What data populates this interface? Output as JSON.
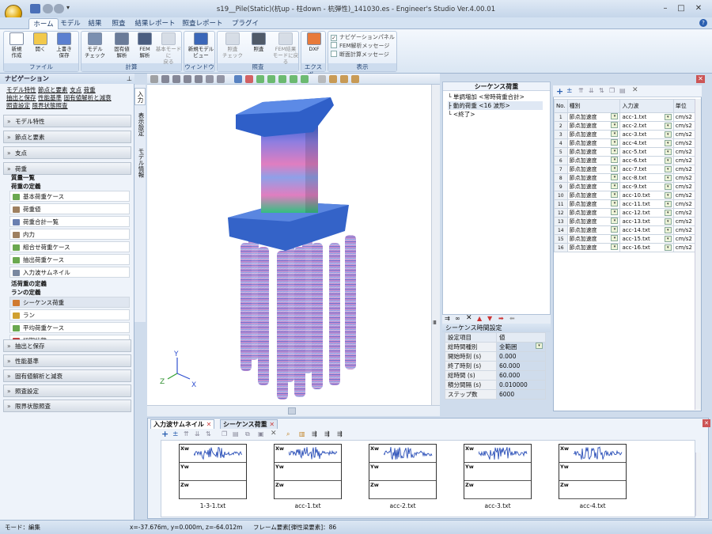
{
  "window": {
    "title": "s19__Pile(Static)(杭up - 柱down - 杭弾性)_141030.es - Engineer's Studio Ver.4.00.01",
    "controls": [
      "–",
      "□",
      "✕"
    ]
  },
  "ribbon_tabs": [
    "ホーム",
    "モデル",
    "結果",
    "照査",
    "結果レポート",
    "照査レポート",
    "プラグイン"
  ],
  "ribbon_groups": {
    "file": "ファイル",
    "calc": "計算",
    "window": "ウィンドウ",
    "check": "照査",
    "export": "エクスポ...",
    "display": "表示"
  },
  "ribbon_buttons": [
    {
      "label": "新規\n作成",
      "icon": "new-file-icon",
      "color": "#ffffff",
      "disabled": false
    },
    {
      "label": "開く",
      "icon": "open-folder-icon",
      "color": "#f2c94c",
      "disabled": false
    },
    {
      "label": "上書き\n保存",
      "icon": "save-icon",
      "color": "#5b7fd0",
      "disabled": false
    },
    {
      "label": "モデル\nチェック",
      "icon": "model-check-icon",
      "color": "#7a8fb0",
      "disabled": false
    },
    {
      "label": "固有値\n解析",
      "icon": "eigen-icon",
      "color": "#6a7b98",
      "disabled": false
    },
    {
      "label": "FEM\n解析",
      "icon": "fem-icon",
      "color": "#4a5d80",
      "disabled": false
    },
    {
      "label": "基本モードに\n戻る",
      "icon": "basic-mode-icon",
      "color": "#b8c2d0",
      "disabled": true
    },
    {
      "label": "新規モデル\nビュー",
      "icon": "model-view-icon",
      "color": "#3a66b8",
      "disabled": false
    },
    {
      "label": "照査\nチェック",
      "icon": "check-icon",
      "color": "#b8c2d0",
      "disabled": true
    },
    {
      "label": "照査",
      "icon": "verify-icon",
      "color": "#505a68",
      "disabled": false
    },
    {
      "label": "FEM結果\nモードに戻る",
      "icon": "fem-mode-icon",
      "color": "#b8c2d0",
      "disabled": true
    },
    {
      "label": "DXF",
      "icon": "dxf-icon",
      "color": "#e87a3a",
      "disabled": false
    }
  ],
  "display_options": [
    {
      "label": "ナビゲーションパネル",
      "checked": true
    },
    {
      "label": "FEM解析メッセージ",
      "checked": false
    },
    {
      "label": "断面計算メッセージ",
      "checked": false
    }
  ],
  "nav": {
    "title": "ナビゲーション",
    "links": [
      [
        "モデル特性",
        "節点と要素",
        "支点",
        "荷重"
      ],
      [
        "抽出と保存",
        "性能基準",
        "固有値解析と減衰"
      ],
      [
        "照査設定",
        "限界状態照査"
      ]
    ],
    "sections_top": [
      "モデル特性",
      "節点と要素",
      "支点",
      "荷重"
    ],
    "load_items": [
      {
        "type": "head",
        "label": "質量一覧"
      },
      {
        "type": "head",
        "label": "荷重の定義"
      },
      {
        "type": "item",
        "label": "基本荷重ケース",
        "icon_color": "#6aa84f"
      },
      {
        "type": "item",
        "label": "荷重値",
        "icon_color": "#9e8060"
      },
      {
        "type": "item",
        "label": "荷重合計一覧",
        "icon_color": "#6a7fb0"
      },
      {
        "type": "item",
        "label": "内力",
        "icon_color": "#9e8060"
      },
      {
        "type": "item",
        "label": "組合せ荷重ケース",
        "icon_color": "#6aa84f"
      },
      {
        "type": "item",
        "label": "抽出荷重ケース",
        "icon_color": "#6aa84f"
      },
      {
        "type": "item",
        "label": "入力波サムネイル",
        "icon_color": "#7a88a0"
      },
      {
        "type": "head",
        "label": "活荷重の定義"
      },
      {
        "type": "head",
        "label": "ランの定義"
      },
      {
        "type": "item",
        "label": "シーケンス荷重",
        "icon_color": "#d07a30",
        "selected": true
      },
      {
        "type": "item",
        "label": "ラン",
        "icon_color": "#d0a030"
      },
      {
        "type": "item",
        "label": "平均荷重ケース",
        "icon_color": "#6aa84f"
      },
      {
        "type": "item",
        "label": "初期状態",
        "icon_color": "#c04040"
      }
    ],
    "sections_bottom": [
      "抽出と保存",
      "性能基準",
      "固有値解析と減衰",
      "照査設定",
      "限界状態照査"
    ]
  },
  "side_tabs": [
    "入力",
    "表示設定",
    "モデル情報"
  ],
  "axes": {
    "y": "Y",
    "z": "Z",
    "x": "X"
  },
  "sequence": {
    "title": "シーケンス荷重",
    "nodes": [
      "単調増加 <常時荷重合計>",
      "動的荷重 <16 波形>",
      "<終了>"
    ]
  },
  "seq_settings": {
    "title": "シーケンス時間設定",
    "header": [
      "設定項目",
      "値"
    ],
    "rows": [
      [
        "総時間種別",
        "全範囲"
      ],
      [
        "開始時刻 (s)",
        "0.000"
      ],
      [
        "終了時刻 (s)",
        "60.000"
      ],
      [
        "総時間 (s)",
        "60.000"
      ],
      [
        "積分間隔 (s)",
        "0.010000"
      ],
      [
        "ステップ数",
        "6000"
      ]
    ]
  },
  "grid": {
    "columns": [
      "No.",
      "種別",
      "入力波",
      "単位"
    ],
    "rows": [
      [
        "1",
        "節点加速度",
        "acc-1.txt",
        "cm/s2"
      ],
      [
        "2",
        "節点加速度",
        "acc-2.txt",
        "cm/s2"
      ],
      [
        "3",
        "節点加速度",
        "acc-3.txt",
        "cm/s2"
      ],
      [
        "4",
        "節点加速度",
        "acc-4.txt",
        "cm/s2"
      ],
      [
        "5",
        "節点加速度",
        "acc-5.txt",
        "cm/s2"
      ],
      [
        "6",
        "節点加速度",
        "acc-6.txt",
        "cm/s2"
      ],
      [
        "7",
        "節点加速度",
        "acc-7.txt",
        "cm/s2"
      ],
      [
        "8",
        "節点加速度",
        "acc-8.txt",
        "cm/s2"
      ],
      [
        "9",
        "節点加速度",
        "acc-9.txt",
        "cm/s2"
      ],
      [
        "10",
        "節点加速度",
        "acc-10.txt",
        "cm/s2"
      ],
      [
        "11",
        "節点加速度",
        "acc-11.txt",
        "cm/s2"
      ],
      [
        "12",
        "節点加速度",
        "acc-12.txt",
        "cm/s2"
      ],
      [
        "13",
        "節点加速度",
        "acc-13.txt",
        "cm/s2"
      ],
      [
        "14",
        "節点加速度",
        "acc-14.txt",
        "cm/s2"
      ],
      [
        "15",
        "節点加速度",
        "acc-15.txt",
        "cm/s2"
      ],
      [
        "16",
        "節点加速度",
        "acc-16.txt",
        "cm/s2"
      ]
    ]
  },
  "bottom_tabs": [
    "入力波サムネイル",
    "シーケンス荷重"
  ],
  "thumbnails": {
    "rows": [
      "Xw",
      "Yw",
      "Zw"
    ],
    "labels": [
      "1-3-1.txt",
      "acc-1.txt",
      "acc-2.txt",
      "acc-3.txt",
      "acc-4.txt"
    ]
  },
  "status": {
    "mode": "モード：編集",
    "coords": "x=-37.676m, y=0.000m, z=-64.012m",
    "element": "フレーム要素[弾性梁要素]：86"
  }
}
